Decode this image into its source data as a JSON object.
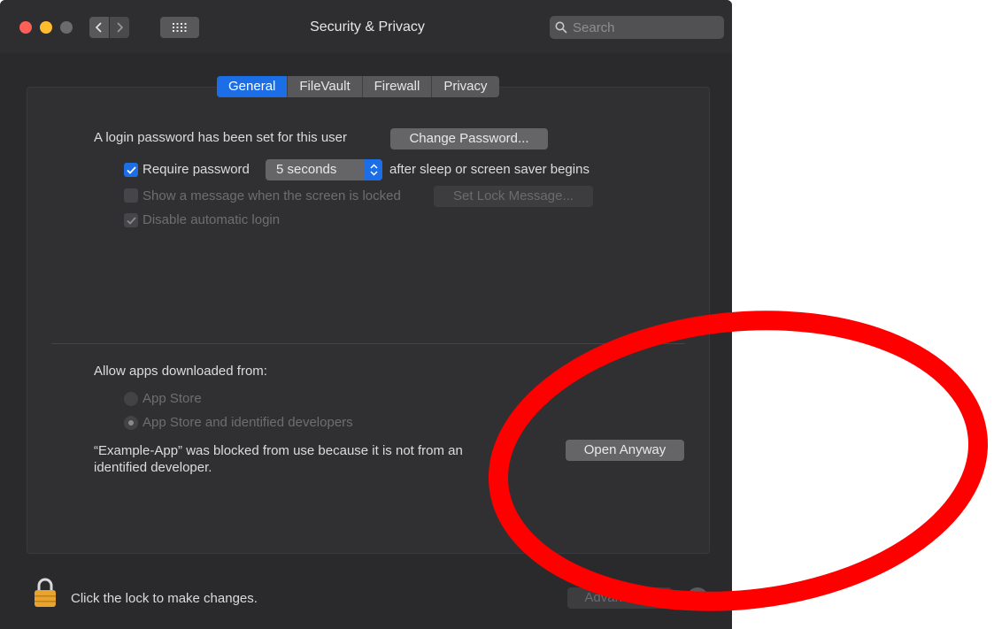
{
  "window": {
    "title": "Security & Privacy"
  },
  "search": {
    "placeholder": "Search"
  },
  "tabs": [
    {
      "label": "General",
      "active": true
    },
    {
      "label": "FileVault",
      "active": false
    },
    {
      "label": "Firewall",
      "active": false
    },
    {
      "label": "Privacy",
      "active": false
    }
  ],
  "general": {
    "login_text": "A login password has been set for this user",
    "change_password_label": "Change Password...",
    "require_password_label": "Require password",
    "require_password_value": "5 seconds",
    "require_password_suffix": "after sleep or screen saver begins",
    "show_message_label": "Show a message when the screen is locked",
    "set_lock_message_label": "Set Lock Message...",
    "disable_autologin_label": "Disable automatic login"
  },
  "allow_apps": {
    "heading": "Allow apps downloaded from:",
    "options": [
      "App Store",
      "App Store and identified developers"
    ],
    "blocked_line1": "“Example-App” was blocked from use because it is not from an",
    "blocked_line2": "identified developer.",
    "open_anyway_label": "Open Anyway"
  },
  "footer": {
    "lock_text": "Click the lock to make changes.",
    "advanced_label": "Advanced...",
    "help_label": "?"
  },
  "colors": {
    "accent": "#1b6ee6",
    "annotation": "#ff0000"
  }
}
